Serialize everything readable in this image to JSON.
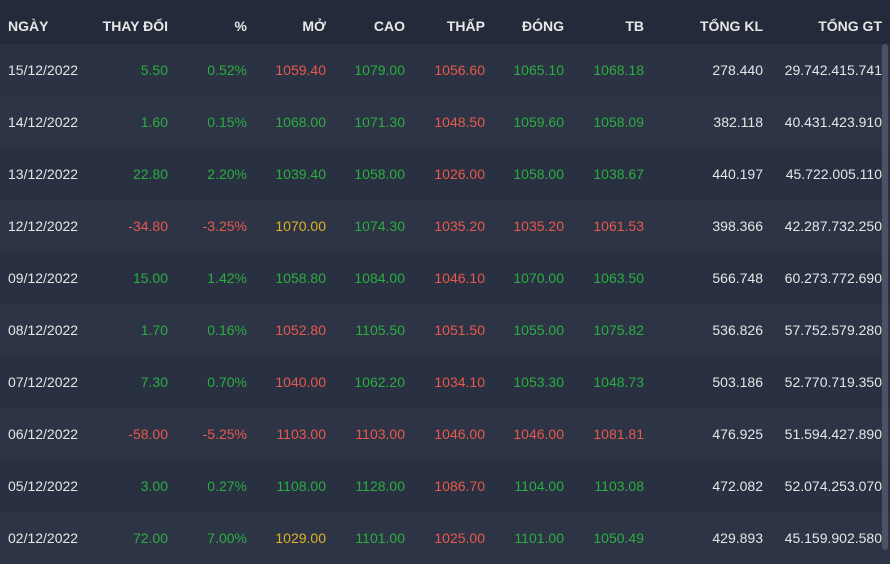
{
  "header": {
    "date": "NGÀY",
    "change": "THAY ĐỔI",
    "percent": "%",
    "open": "MỞ",
    "high": "CAO",
    "low": "THẤP",
    "close": "ĐÓNG",
    "avg": "TB",
    "total_volume": "TỔNG KL",
    "total_value": "TỔNG GT"
  },
  "colors": {
    "up": "#2cae3f",
    "down": "#e8594d",
    "reference": "#e0b12a",
    "background": "#283041",
    "header_background": "#232a39"
  },
  "rows": [
    {
      "date": "15/12/2022",
      "change": "5.50",
      "percent": "0.52%",
      "open": "1059.40",
      "high": "1079.00",
      "low": "1056.60",
      "close": "1065.10",
      "avg": "1068.18",
      "volume": "278.440",
      "value": "29.742.415.741",
      "colors": {
        "change": "up",
        "percent": "up",
        "open": "down",
        "high": "up",
        "low": "down",
        "close": "up",
        "avg": "up"
      }
    },
    {
      "date": "14/12/2022",
      "change": "1.60",
      "percent": "0.15%",
      "open": "1068.00",
      "high": "1071.30",
      "low": "1048.50",
      "close": "1059.60",
      "avg": "1058.09",
      "volume": "382.118",
      "value": "40.431.423.910",
      "colors": {
        "change": "up",
        "percent": "up",
        "open": "up",
        "high": "up",
        "low": "down",
        "close": "up",
        "avg": "up"
      }
    },
    {
      "date": "13/12/2022",
      "change": "22.80",
      "percent": "2.20%",
      "open": "1039.40",
      "high": "1058.00",
      "low": "1026.00",
      "close": "1058.00",
      "avg": "1038.67",
      "volume": "440.197",
      "value": "45.722.005.110",
      "colors": {
        "change": "up",
        "percent": "up",
        "open": "up",
        "high": "up",
        "low": "down",
        "close": "up",
        "avg": "up"
      }
    },
    {
      "date": "12/12/2022",
      "change": "-34.80",
      "percent": "-3.25%",
      "open": "1070.00",
      "high": "1074.30",
      "low": "1035.20",
      "close": "1035.20",
      "avg": "1061.53",
      "volume": "398.366",
      "value": "42.287.732.250",
      "colors": {
        "change": "down",
        "percent": "down",
        "open": "ref",
        "high": "up",
        "low": "down",
        "close": "down",
        "avg": "down"
      }
    },
    {
      "date": "09/12/2022",
      "change": "15.00",
      "percent": "1.42%",
      "open": "1058.80",
      "high": "1084.00",
      "low": "1046.10",
      "close": "1070.00",
      "avg": "1063.50",
      "volume": "566.748",
      "value": "60.273.772.690",
      "colors": {
        "change": "up",
        "percent": "up",
        "open": "up",
        "high": "up",
        "low": "down",
        "close": "up",
        "avg": "up"
      }
    },
    {
      "date": "08/12/2022",
      "change": "1.70",
      "percent": "0.16%",
      "open": "1052.80",
      "high": "1105.50",
      "low": "1051.50",
      "close": "1055.00",
      "avg": "1075.82",
      "volume": "536.826",
      "value": "57.752.579.280",
      "colors": {
        "change": "up",
        "percent": "up",
        "open": "down",
        "high": "up",
        "low": "down",
        "close": "up",
        "avg": "up"
      }
    },
    {
      "date": "07/12/2022",
      "change": "7.30",
      "percent": "0.70%",
      "open": "1040.00",
      "high": "1062.20",
      "low": "1034.10",
      "close": "1053.30",
      "avg": "1048.73",
      "volume": "503.186",
      "value": "52.770.719.350",
      "colors": {
        "change": "up",
        "percent": "up",
        "open": "down",
        "high": "up",
        "low": "down",
        "close": "up",
        "avg": "up"
      }
    },
    {
      "date": "06/12/2022",
      "change": "-58.00",
      "percent": "-5.25%",
      "open": "1103.00",
      "high": "1103.00",
      "low": "1046.00",
      "close": "1046.00",
      "avg": "1081.81",
      "volume": "476.925",
      "value": "51.594.427.890",
      "colors": {
        "change": "down",
        "percent": "down",
        "open": "down",
        "high": "down",
        "low": "down",
        "close": "down",
        "avg": "down"
      }
    },
    {
      "date": "05/12/2022",
      "change": "3.00",
      "percent": "0.27%",
      "open": "1108.00",
      "high": "1128.00",
      "low": "1086.70",
      "close": "1104.00",
      "avg": "1103.08",
      "volume": "472.082",
      "value": "52.074.253.070",
      "colors": {
        "change": "up",
        "percent": "up",
        "open": "up",
        "high": "up",
        "low": "down",
        "close": "up",
        "avg": "up"
      }
    },
    {
      "date": "02/12/2022",
      "change": "72.00",
      "percent": "7.00%",
      "open": "1029.00",
      "high": "1101.00",
      "low": "1025.00",
      "close": "1101.00",
      "avg": "1050.49",
      "volume": "429.893",
      "value": "45.159.902.580",
      "colors": {
        "change": "up",
        "percent": "up",
        "open": "ref",
        "high": "up",
        "low": "down",
        "close": "up",
        "avg": "up"
      }
    }
  ]
}
